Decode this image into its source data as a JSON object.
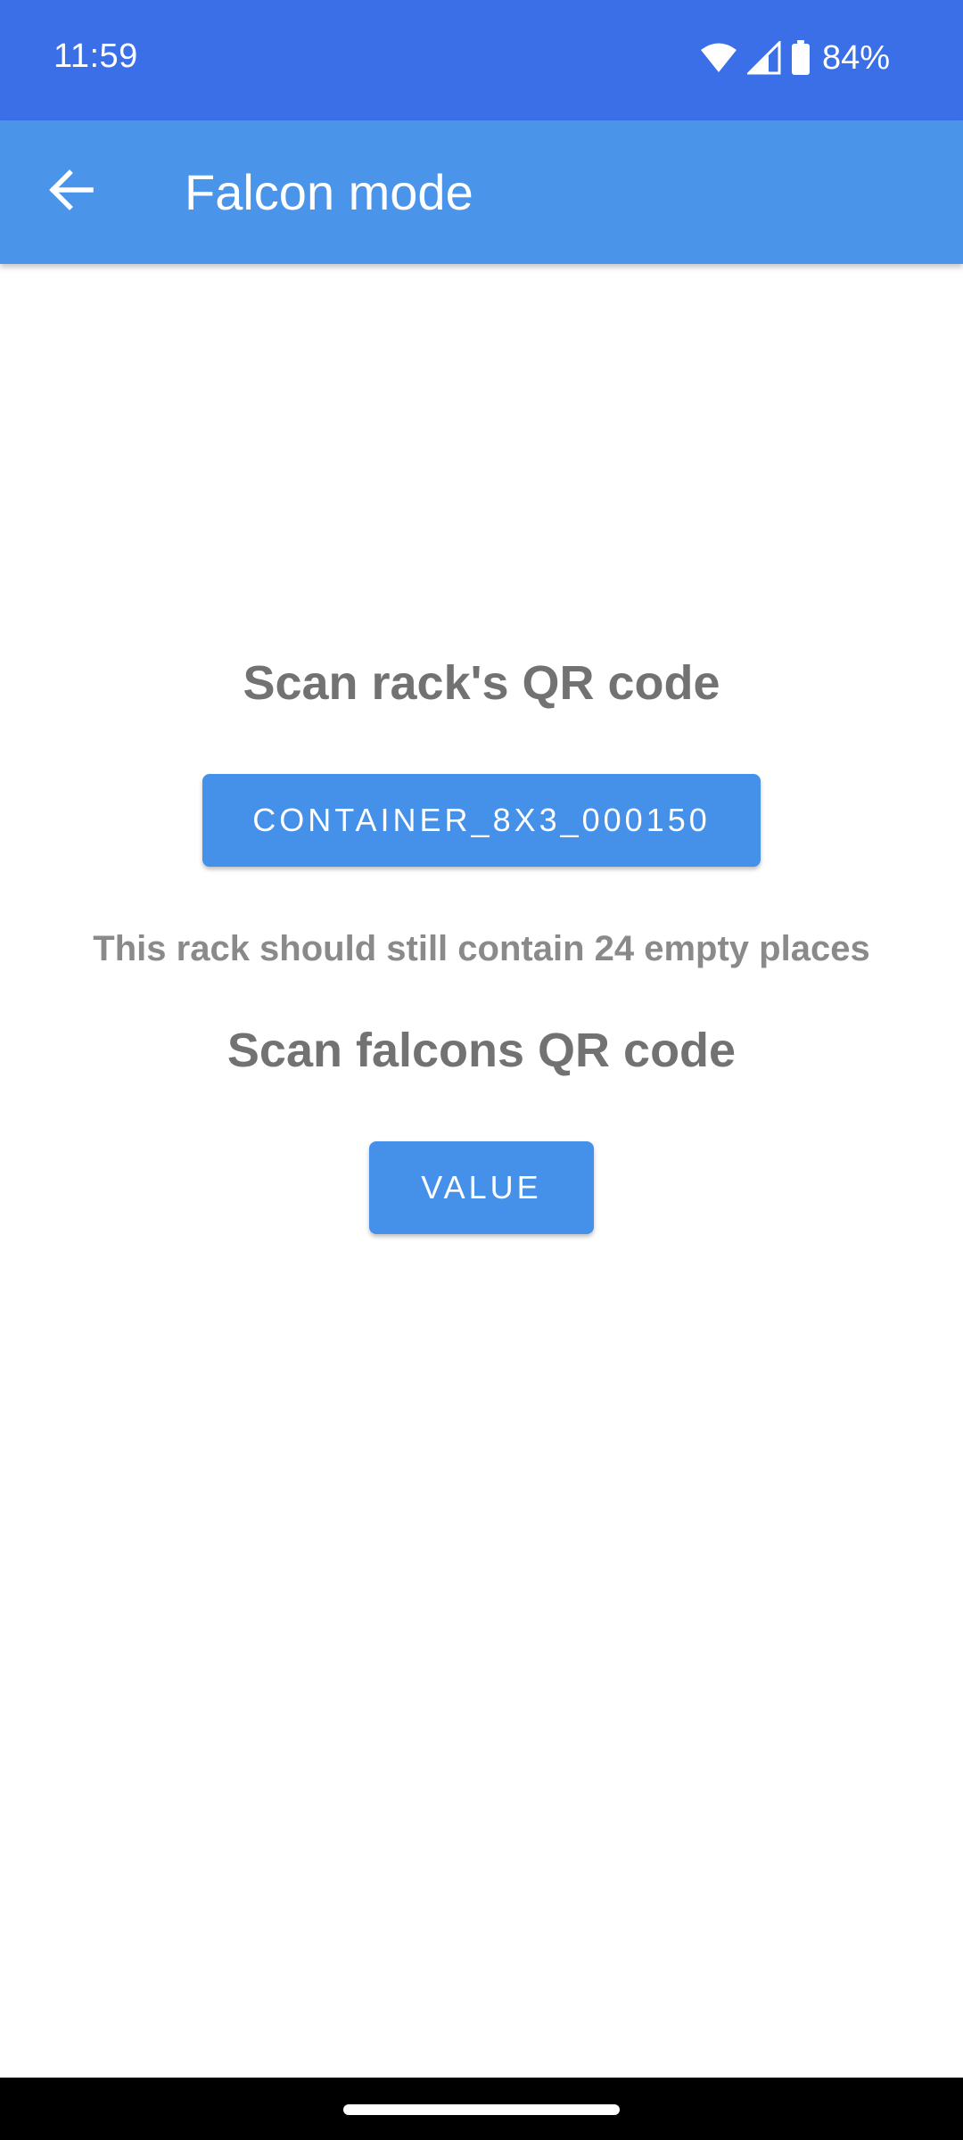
{
  "status_bar": {
    "time": "11:59",
    "battery_percent": "84%",
    "icons": [
      "wifi-icon",
      "cellular-signal-icon",
      "battery-icon"
    ]
  },
  "app_bar": {
    "title": "Falcon mode",
    "back_icon": "arrow-back-icon"
  },
  "main": {
    "rack_heading": "Scan rack's QR code",
    "rack_button_label": "CONTAINER_8X3_000150",
    "rack_info": "This rack should still contain 24 empty places",
    "falcon_heading": "Scan falcons QR code",
    "falcon_button_label": "VALUE"
  },
  "colors": {
    "status_bar": "#3a6fe8",
    "app_bar": "#4a94ea",
    "button": "#4590e8",
    "heading_text": "#727272",
    "info_text": "#8a8a8a"
  }
}
